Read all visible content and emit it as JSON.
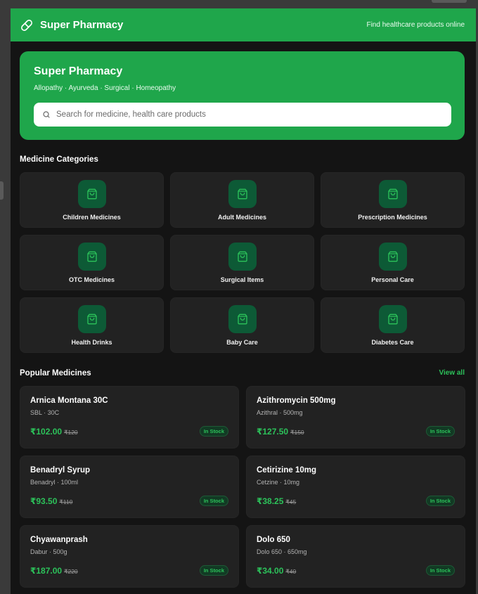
{
  "header": {
    "brand": "Super Pharmacy",
    "tagline": "Find healthcare products online"
  },
  "hero": {
    "title": "Super Pharmacy",
    "subtitle": "Allopathy · Ayurveda · Surgical · Homeopathy",
    "search_placeholder": "Search for medicine, health care products"
  },
  "categories": {
    "title": "Medicine Categories",
    "items": [
      {
        "label": "Children Medicines",
        "icon": "shopping-bag-icon"
      },
      {
        "label": "Adult Medicines",
        "icon": "shopping-bag-icon"
      },
      {
        "label": "Prescription Medicines",
        "icon": "shopping-bag-icon"
      },
      {
        "label": "OTC Medicines",
        "icon": "shopping-bag-icon"
      },
      {
        "label": "Surgical Items",
        "icon": "shopping-bag-icon"
      },
      {
        "label": "Personal Care",
        "icon": "shopping-bag-icon"
      },
      {
        "label": "Health Drinks",
        "icon": "shopping-bag-icon"
      },
      {
        "label": "Baby Care",
        "icon": "shopping-bag-icon"
      },
      {
        "label": "Diabetes Care",
        "icon": "shopping-bag-icon"
      }
    ]
  },
  "popular": {
    "title": "Popular Medicines",
    "view_all": "View all",
    "items": [
      {
        "name": "Arnica Montana 30C",
        "sub": "SBL · 30C",
        "price": "₹102.00",
        "mrp": "₹120",
        "stock": "In Stock"
      },
      {
        "name": "Azithromycin 500mg",
        "sub": "Azithral · 500mg",
        "price": "₹127.50",
        "mrp": "₹150",
        "stock": "In Stock"
      },
      {
        "name": "Benadryl Syrup",
        "sub": "Benadryl · 100ml",
        "price": "₹93.50",
        "mrp": "₹110",
        "stock": "In Stock"
      },
      {
        "name": "Cetirizine 10mg",
        "sub": "Cetzine · 10mg",
        "price": "₹38.25",
        "mrp": "₹45",
        "stock": "In Stock"
      },
      {
        "name": "Chyawanprash",
        "sub": "Dabur · 500g",
        "price": "₹187.00",
        "mrp": "₹220",
        "stock": "In Stock"
      },
      {
        "name": "Dolo 650",
        "sub": "Dolo 650 · 650mg",
        "price": "₹34.00",
        "mrp": "₹40",
        "stock": "In Stock"
      }
    ]
  },
  "colors": {
    "accent": "#1fa64b",
    "price": "#2cc25a",
    "card": "#222222",
    "background": "#141414"
  }
}
